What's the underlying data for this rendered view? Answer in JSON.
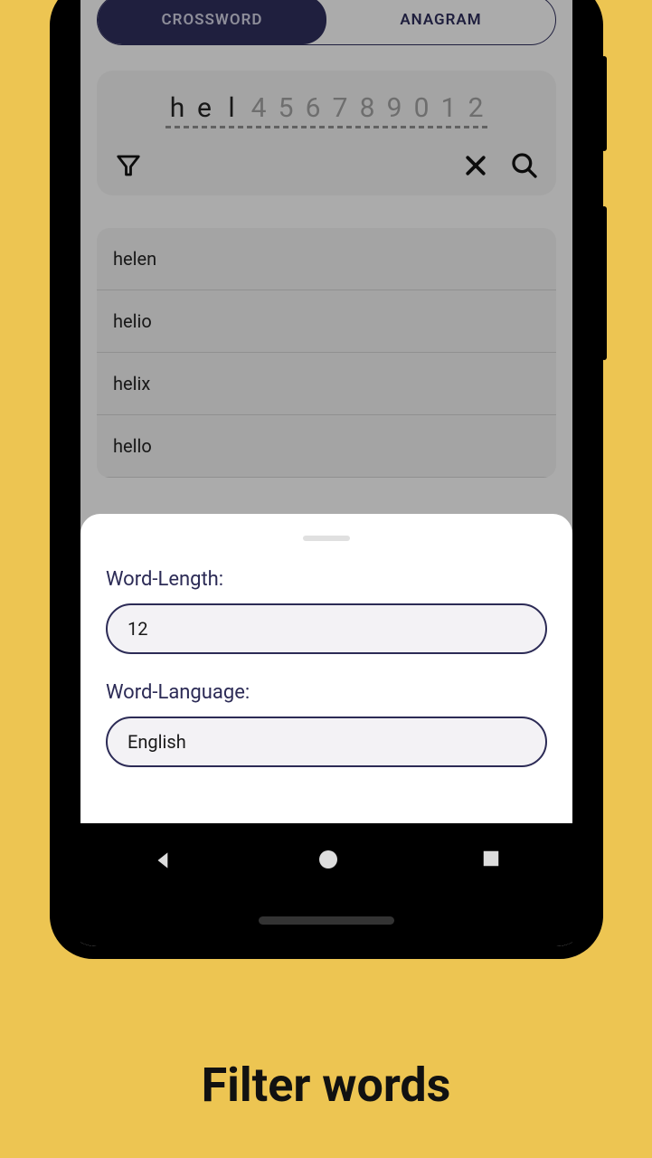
{
  "tabs": {
    "crossword": "CROSSWORD",
    "anagram": "ANAGRAM"
  },
  "search": {
    "letters": [
      "h",
      "e",
      "l"
    ],
    "placeholders": [
      "4",
      "5",
      "6",
      "7",
      "8",
      "9",
      "0",
      "1",
      "2"
    ]
  },
  "results": {
    "items": [
      "helen",
      "helio",
      "helix",
      "hello"
    ]
  },
  "sheet": {
    "wordLengthLabel": "Word-Length:",
    "wordLengthValue": "12",
    "wordLanguageLabel": "Word-Language:",
    "wordLanguageValue": "English"
  },
  "caption": "Filter words"
}
